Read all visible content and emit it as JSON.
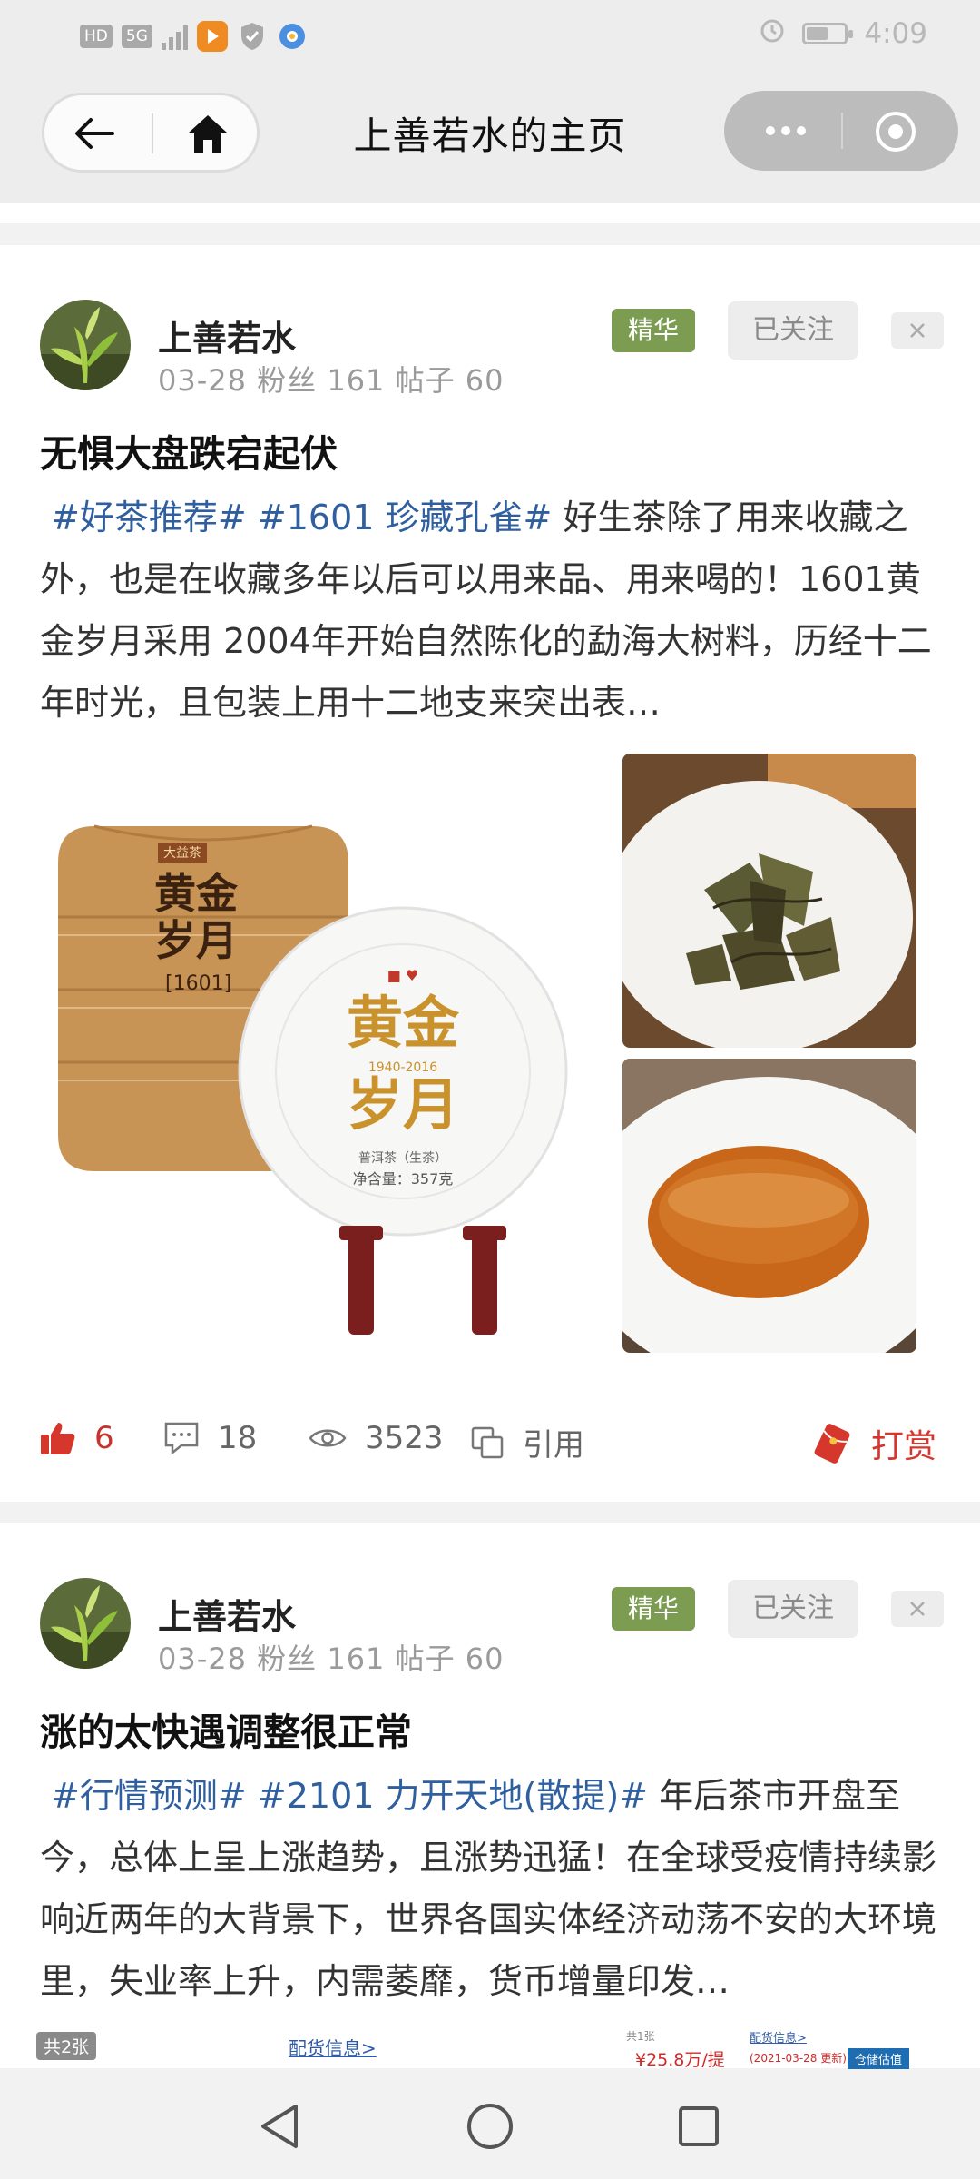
{
  "status_bar": {
    "left_tags": [
      "HD",
      "5G"
    ],
    "time": "4:09",
    "battery_level": 0.6
  },
  "header": {
    "title": "上善若水的主页"
  },
  "posts": [
    {
      "username": "上善若水",
      "meta": "03-28 粉丝 161 帖子 60",
      "badge": "精华",
      "follow_label": "已关注",
      "title": "无惧大盘跌宕起伏",
      "tags": [
        "#好茶推荐#",
        "#1601 珍藏孔雀#"
      ],
      "body": "好生茶除了用来收藏之外，也是在收藏多年以后可以用来品、用来喝的！1601黄金岁月采用 2004年开始自然陈化的勐海大树料，历经十二年时光，且包装上用十二地支来突出表…",
      "stats": {
        "likes": "6",
        "comments": "18",
        "views": "3523",
        "quote_label": "引用",
        "tip_label": "打赏"
      },
      "image_texts": {
        "brand_top": "大益茶",
        "stack_title": "黄金岁月",
        "stack_code": "[1601]",
        "cake_title": "黄金岁月",
        "cake_sub": "1940-2016",
        "cake_type": "普洱茶（生茶）",
        "cake_weight": "净含量：357克"
      }
    },
    {
      "username": "上善若水",
      "meta": "03-28 粉丝 161 帖子 60",
      "badge": "精华",
      "follow_label": "已关注",
      "title": "涨的太快遇调整很正常",
      "tags": [
        "#行情预测#",
        "#2101 力开天地(散提)#"
      ],
      "body": "年后茶市开盘至今，总体上呈上涨趋势，且涨势迅猛！在全球受疫情持续影响近两年的大背景下，世界各国实体经济动荡不安的大环境里，失业率上升，内需萎靡，货币增量印发…",
      "strip": {
        "count_chip": "共2张",
        "link1": "配货信息>",
        "mini_label": "共1张",
        "link2": "配货信息>",
        "price": "¥25.8万/提",
        "date": "(2021-03-28 更新)",
        "badge": "仓储估值"
      }
    }
  ],
  "icons": {
    "back": "back-arrow-icon",
    "home": "home-icon",
    "more": "more-dots-icon",
    "close": "target-close-icon",
    "like": "thumbs-up-icon",
    "comment": "comment-icon",
    "views": "eye-icon",
    "quote": "quote-icon",
    "tip": "red-envelope-icon"
  },
  "colors": {
    "accent_red": "#d6372d",
    "tag_blue": "#2f5f9f",
    "badge_green": "#7c9c52"
  }
}
